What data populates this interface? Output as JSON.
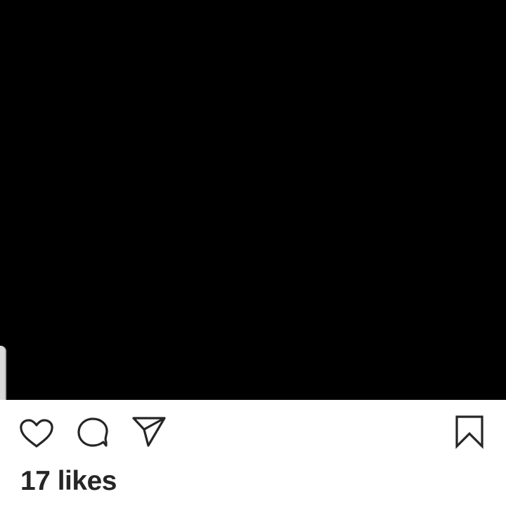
{
  "colors": {
    "media_background": "#000000",
    "icon_stroke": "#262626",
    "text": "#262626",
    "surface": "#ffffff"
  },
  "actions": {
    "like_icon": "heart-outline",
    "comment_icon": "speech-bubble-outline",
    "share_icon": "paper-plane-outline",
    "save_icon": "bookmark-outline"
  },
  "post": {
    "likes_text": "17 likes"
  }
}
